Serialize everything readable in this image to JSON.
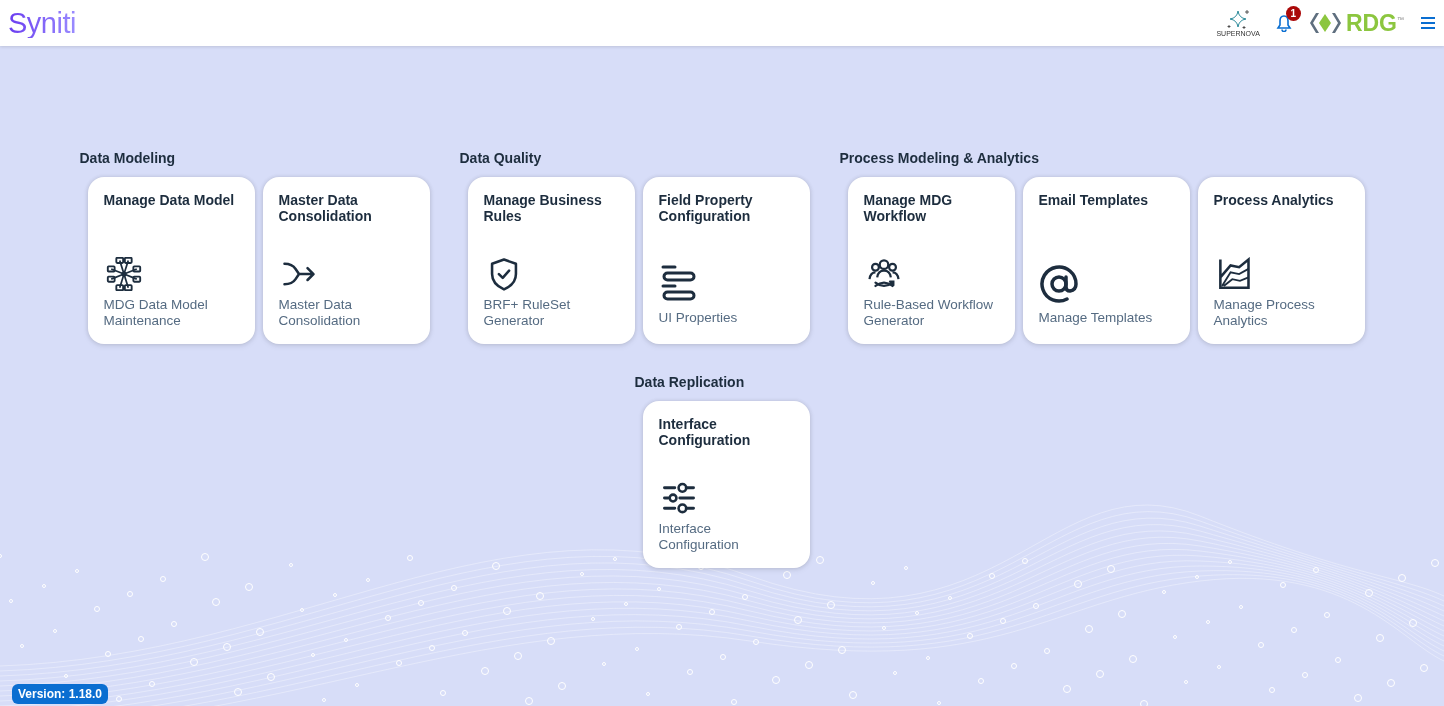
{
  "header": {
    "logo": "Syniti",
    "supernova_label": "SUPERNOVA",
    "notification_count": "1",
    "rdg_text": "RDG",
    "rdg_trademark": "™"
  },
  "rows": [
    {
      "groups": [
        {
          "title": "Data Modeling",
          "tiles": [
            {
              "title": "Manage Data Model",
              "subtitle": "MDG Data Model Maintenance",
              "kind": "network"
            },
            {
              "title": "Master Data Consolidation",
              "subtitle": "Master Data Consolidation",
              "kind": "merge"
            }
          ]
        },
        {
          "title": "Data Quality",
          "tiles": [
            {
              "title": "Manage Business Rules",
              "subtitle": "BRF+ RuleSet Generator",
              "kind": "shield"
            },
            {
              "title": "Field Property Configuration",
              "subtitle": "UI Properties",
              "kind": "bars"
            }
          ]
        },
        {
          "title": "Process Modeling & Analytics",
          "tiles": [
            {
              "title": "Manage MDG Workflow",
              "subtitle": "Rule-Based Workflow Generator",
              "kind": "people"
            },
            {
              "title": "Email Templates",
              "subtitle": "Manage Templates",
              "kind": "at"
            },
            {
              "title": "Process Analytics",
              "subtitle": "Manage Process Analytics",
              "kind": "chart"
            }
          ]
        }
      ]
    },
    {
      "groups": [
        {
          "title": "Data Replication",
          "tiles": [
            {
              "title": "Interface Configuration",
              "subtitle": "Interface Configuration",
              "kind": "sliders"
            }
          ]
        }
      ]
    }
  ],
  "version": "Version: 1.18.0"
}
